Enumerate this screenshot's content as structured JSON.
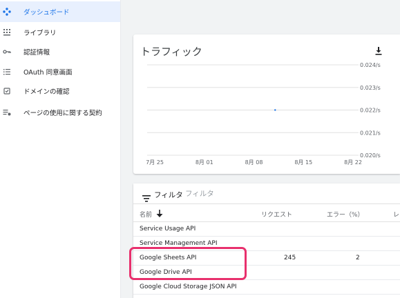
{
  "sidebar": {
    "items": [
      {
        "label": "ダッシュボード",
        "icon": "dashboard-icon",
        "active": true
      },
      {
        "label": "ライブラリ",
        "icon": "library-icon",
        "active": false
      },
      {
        "label": "認証情報",
        "icon": "key-icon",
        "active": false
      },
      {
        "label": "OAuth 同意画面",
        "icon": "oauth-consent-icon",
        "active": false
      },
      {
        "label": "ドメインの確認",
        "icon": "domain-verification-icon",
        "active": false
      },
      {
        "label": "ページの使用に関する契約",
        "icon": "page-agreement-icon",
        "active": false
      }
    ]
  },
  "traffic": {
    "title": "トラフィック",
    "download_icon": "download-icon"
  },
  "chart_data": {
    "type": "line",
    "title": "トラフィック",
    "xlabel": "",
    "ylabel": "",
    "x_ticks": [
      "7月 25",
      "8月 01",
      "8月 08",
      "8月 15",
      "8月 22"
    ],
    "y_ticks": [
      "0.024/s",
      "0.023/s",
      "0.022/s",
      "0.021/s",
      "0.020/s"
    ],
    "ylim": [
      0.02,
      0.024
    ],
    "grid": true,
    "series": [
      {
        "points": [
          {
            "x": "8月 11",
            "y": 0.022
          }
        ]
      }
    ]
  },
  "filter": {
    "label": "フィルタ",
    "placeholder": "フィルタ"
  },
  "table": {
    "columns": [
      "名前",
      "リクエスト",
      "エラー（%）",
      "レ"
    ],
    "rows": [
      {
        "name": "Service Usage API",
        "requests": "",
        "errors": ""
      },
      {
        "name": "Service Management API",
        "requests": "",
        "errors": ""
      },
      {
        "name": "Google Sheets API",
        "requests": "245",
        "errors": "2"
      },
      {
        "name": "Google Drive API",
        "requests": "",
        "errors": ""
      },
      {
        "name": "Google Cloud Storage JSON API",
        "requests": "",
        "errors": ""
      }
    ]
  },
  "colors": {
    "accent": "#1a73e8",
    "active_bg": "#e8f0fe",
    "highlight": "#e8306d",
    "grid": "#e0e0e0"
  }
}
